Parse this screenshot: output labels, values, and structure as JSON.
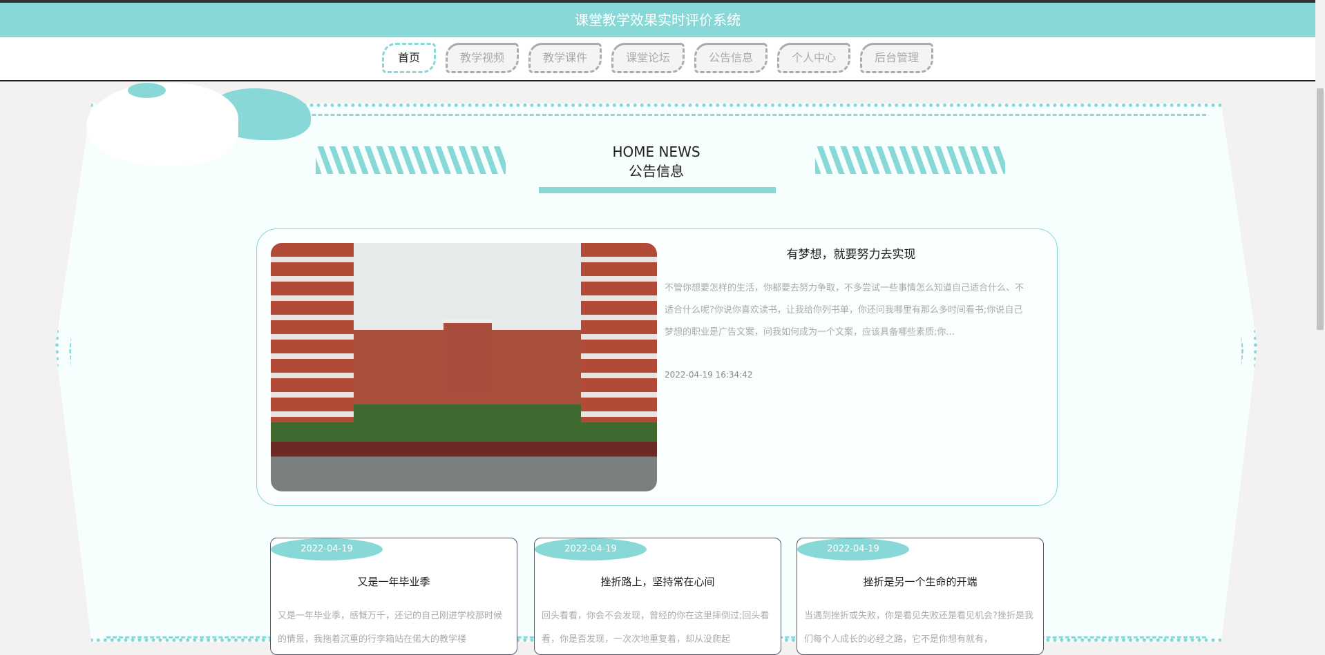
{
  "header": {
    "title": "课堂教学效果实时评价系统"
  },
  "nav": [
    "首页",
    "教学视频",
    "教学课件",
    "课堂论坛",
    "公告信息",
    "个人中心",
    "后台管理"
  ],
  "section": {
    "title_en": "HOME NEWS",
    "title_cn": "公告信息"
  },
  "featured": {
    "title": "有梦想，就要努力去实现",
    "desc": "不管你想要怎样的生活，你都要去努力争取，不多尝试一些事情怎么知道自己适合什么、不适合什么呢?你说你喜欢读书，让我给你列书单，你还问我哪里有那么多时间看书;你说自己梦想的职业是广告文案，问我如何成为一个文案，应该具备哪些素质;你...",
    "time": "2022-04-19 16:34:42"
  },
  "cards": [
    {
      "date": "2022-04-19",
      "title": "又是一年毕业季",
      "desc": "又是一年毕业季，感慨万千，还记的自己刚进学校那时候的情景，我拖着沉重的行李箱站在偌大的教学楼"
    },
    {
      "date": "2022-04-19",
      "title": "挫折路上，坚持常在心间",
      "desc": "回头看看，你会不会发现，曾经的你在这里摔倒过;回头看看，你是否发现，一次次地重复着，却从没爬起"
    },
    {
      "date": "2022-04-19",
      "title": "挫折是另一个生命的开端",
      "desc": "当遇到挫折或失败，你是看见失败还是看见机会?挫折是我们每个人成长的必经之路，它不是你想有就有，"
    }
  ],
  "colors": {
    "accent": "#89d8d8"
  }
}
